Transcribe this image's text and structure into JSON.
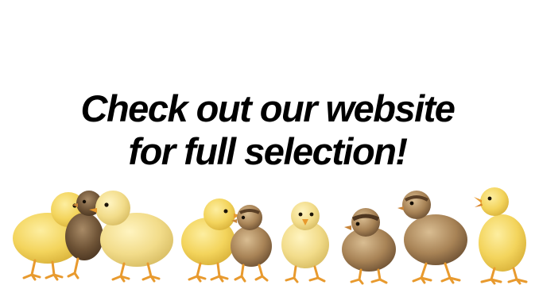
{
  "headline": {
    "line1": "Check out our website",
    "line2": "for full selection!"
  },
  "colors": {
    "background": "#ffffff",
    "text": "#000000",
    "chick_yellow": "#f3d45c",
    "chick_pale": "#f7e08a",
    "chick_brown": "#8a6a45",
    "chick_tan": "#b99466",
    "legs": "#e89a2e"
  },
  "illustration": {
    "name": "row-of-baby-chicks",
    "count": 9
  }
}
